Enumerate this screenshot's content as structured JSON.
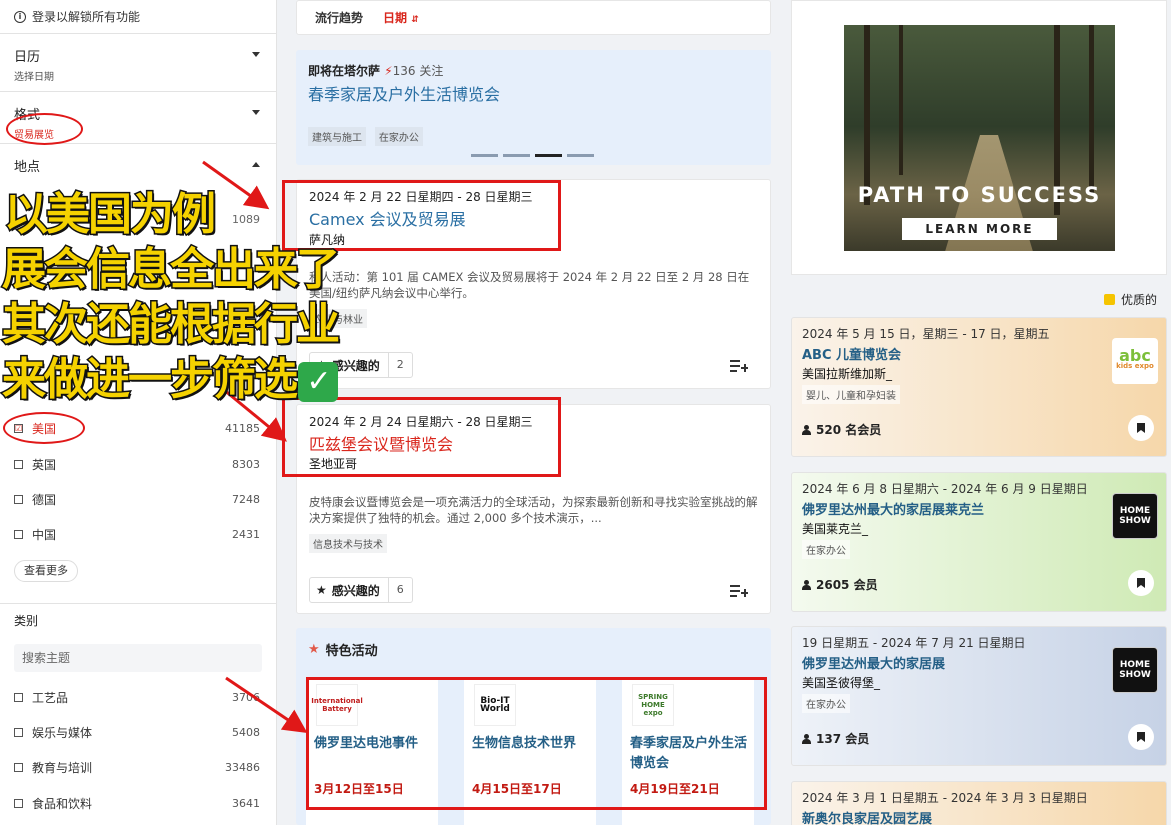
{
  "sidebar": {
    "login": "登录以解锁所有功能",
    "calendar": {
      "title": "日历",
      "sub": "选择日期"
    },
    "format": {
      "title": "格式",
      "sub": "贸易展览"
    },
    "location": {
      "title": "地点"
    },
    "hidden_counts": [
      "1089"
    ],
    "countries": [
      {
        "name": "美国",
        "count": "41185",
        "checked": true
      },
      {
        "name": "英国",
        "count": "8303"
      },
      {
        "name": "德国",
        "count": "7248"
      },
      {
        "name": "中国",
        "count": "2431"
      }
    ],
    "see_more": "查看更多",
    "category": {
      "title": "类别",
      "search_placeholder": "搜索主题",
      "items": [
        {
          "name": "工艺品",
          "count": "3706"
        },
        {
          "name": "娱乐与媒体",
          "count": "5408"
        },
        {
          "name": "教育与培训",
          "count": "33486"
        },
        {
          "name": "食品和饮料",
          "count": "3641"
        }
      ]
    }
  },
  "sort": {
    "trending": "流行趋势",
    "date": "日期"
  },
  "promo": {
    "heading": "即将在塔尔萨",
    "follow": "136 关注",
    "title": "春季家居及户外生活博览会",
    "tags": [
      "建筑与施工",
      "在家办公"
    ]
  },
  "events": [
    {
      "date": "2024 年 2 月 22 日星期四 - 28 日星期三",
      "title": "Camex 会议及贸易展",
      "location": "萨凡纳",
      "desc": "私人活动：第 101 届 CAMEX 会议及贸易展将于 2024 年 2 月 22 日至 2 月 28 日在美国/纽约萨凡纳会议中心举行。",
      "tag": "农业与林业",
      "interest_label": "感兴趣的",
      "interest_count": "2"
    },
    {
      "date": "2024 年 2 月 24 日星期六 - 28 日星期三",
      "title": "匹兹堡会议暨博览会",
      "location": "圣地亚哥",
      "desc": "皮特康会议暨博览会是一项充满活力的全球活动，为探索最新创新和寻找实验室挑战的解决方案提供了独特的机会。通过 2,000 多个技术演示，...",
      "tag": "信息技术与技术",
      "interest_label": "感兴趣的",
      "interest_count": "6"
    }
  ],
  "featured": {
    "heading": "特色活动",
    "items": [
      {
        "logo": "International Battery",
        "title": "佛罗里达电池事件",
        "date": "3月12日至15日"
      },
      {
        "logo": "Bio-IT World",
        "title": "生物信息技术世界",
        "date": "4月15日至17日"
      },
      {
        "logo": "SPRING HOME expo",
        "title": "春季家居及户外生活博览会",
        "date": "4月19日至21日"
      }
    ]
  },
  "ad": {
    "headline": "PATH TO SUCCESS",
    "button": "LEARN MORE"
  },
  "legend": {
    "label": "优质的",
    "color": "#f5c400"
  },
  "right_cards": [
    {
      "date": "2024 年 5 月 15 日，星期三 - 17 日，星期五",
      "title": "ABC 儿童博览会",
      "location": "美国拉斯维加斯_",
      "tag": "婴儿、儿童和孕妇装",
      "members": "520 名会员",
      "logo": "abc",
      "logo_sub": "kids expo"
    },
    {
      "date": "2024 年 6 月 8 日星期六 - 2024 年 6 月 9 日星期日",
      "title": "佛罗里达州最大的家居展莱克兰",
      "location": "美国莱克兰_",
      "tag": "在家办公",
      "members": "2605 会员",
      "logo": "HOME SHOW"
    },
    {
      "date": "19 日星期五 - 2024 年 7 月 21 日星期日",
      "title": "佛罗里达州最大的家居展",
      "location": "美国圣彼得堡_",
      "tag": "在家办公",
      "members": "137 会员",
      "logo": "HOME SHOW"
    },
    {
      "date": "2024 年 3 月 1 日星期五 - 2024 年 3 月 3 日星期日",
      "title": "新奥尔良家居及园艺展"
    }
  ],
  "overlay_text": [
    "以美国为例",
    "展会信息全出来了",
    "其次还能根据行业",
    "来做进一步筛选"
  ]
}
